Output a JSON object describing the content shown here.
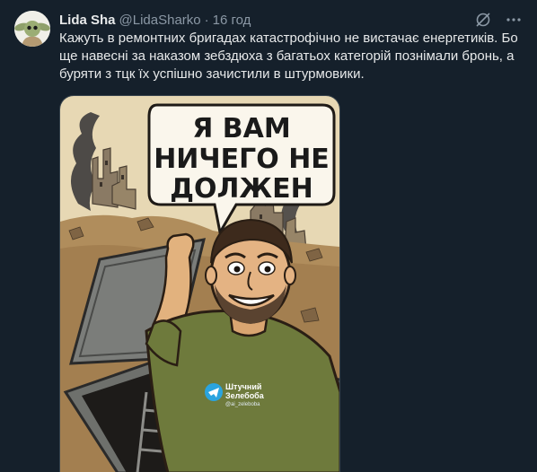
{
  "tweet": {
    "name": "Lida Sha",
    "handle": "@LidaSharko",
    "separator": "·",
    "time": "16 год",
    "text_lines": [
      "Кажуть в ремонтних бригадах катастрофічно не вистачає енергетиків. Бо",
      "ще навесні за наказом зебздюха з багатьох категорій познімали бронь, а",
      "буряти з тцк їх успішно зачистили в штурмовики."
    ],
    "avatar_icon": "grogu-avatar-icon",
    "top_icons": [
      "grok-icon",
      "more-icon"
    ]
  },
  "media": {
    "speech_lines": [
      "Я ВАМ",
      "НИЧЕГО НЕ",
      "ДОЛЖЕН"
    ],
    "watermark_title": [
      "Штучний",
      "Зелебоба"
    ],
    "watermark_sub": "@ai_zelebobа",
    "logo_icon": "telegram-icon"
  },
  "colors": {
    "background": "#15202b",
    "text": "#e7e9ea",
    "secondary": "#8b98a5",
    "image_bg": "#e8d9b6",
    "shirt": "#6e7a3c"
  }
}
